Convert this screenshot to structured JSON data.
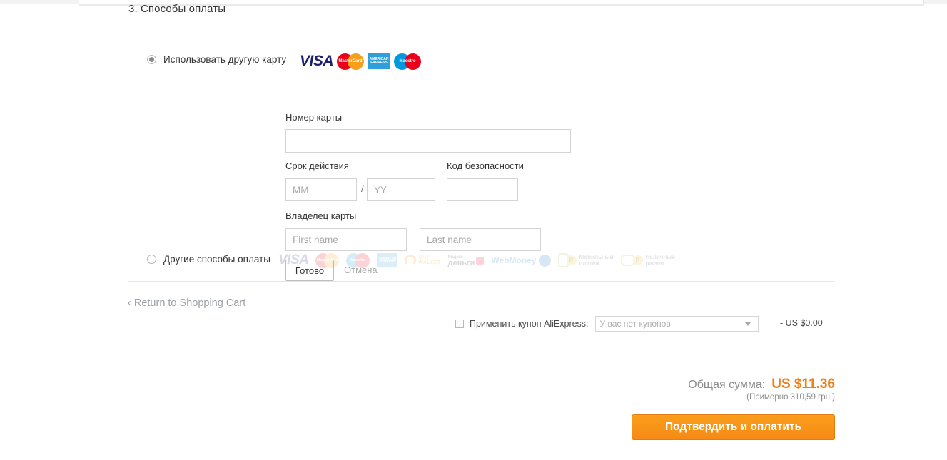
{
  "section": {
    "title": "3. Способы оплаты"
  },
  "payment_panel": {
    "options": [
      {
        "id": "other-card",
        "label": "Использовать другую карту",
        "selected": true,
        "brands": [
          "visa",
          "mastercard",
          "amex",
          "maestro"
        ]
      },
      {
        "id": "other-methods",
        "label": "Другие способы оплаты",
        "selected": false,
        "brands": [
          "visa",
          "mastercard",
          "maestro",
          "amex",
          "qiwi-wallet",
          "yandex-dengi",
          "webmoney",
          "mobile-payment",
          "cash-payment"
        ]
      }
    ],
    "brand_text": {
      "visa": "VISA",
      "mastercard": "MasterCard",
      "maestro": "Maestro",
      "amex": "AMERICAN EXPRESS",
      "qiwi_line1": "QIWI",
      "qiwi_line2": "WALLET",
      "yandex_line1": "Яндекс",
      "yandex_line2": "деньги",
      "webmoney": "WebMoney",
      "mobile_line1": "Мобильный",
      "mobile_line2": "платёж",
      "mobile_coin": "P",
      "cash_line1": "Наличный",
      "cash_line2": "расчет",
      "cash_coin": "P"
    },
    "form": {
      "card_number_label": "Номер карты",
      "card_number_value": "",
      "card_number_placeholder": "",
      "expiry_label": "Срок действия",
      "expiry_separator": "/",
      "mm_value": "",
      "mm_placeholder": "MM",
      "yy_value": "",
      "yy_placeholder": "YY",
      "cvv_label": "Код безопасности",
      "cvv_value": "",
      "cvv_placeholder": "",
      "holder_label": "Владелец карты",
      "first_name_value": "",
      "first_name_placeholder": "First name",
      "last_name_value": "",
      "last_name_placeholder": "Last name",
      "done_button": "Готово",
      "cancel_button": "Отмена"
    }
  },
  "return_link": "‹ Return to Shopping Cart",
  "coupon": {
    "label": "Применить купон AliExpress:",
    "checked": false,
    "selected_option": "У вас нет купонов",
    "amount": "- US $0.00"
  },
  "totals": {
    "label": "Общая сумма:",
    "value": "US $11.36",
    "approx": "(Примерно 310,59 грн.)"
  },
  "confirm_button": "Подтвердить и оплатить",
  "colors": {
    "accent_orange": "#ef7f1a",
    "button_orange": "#fb9e1b",
    "panel_border": "#e6e6e6",
    "muted_text": "#8c8c8c"
  }
}
